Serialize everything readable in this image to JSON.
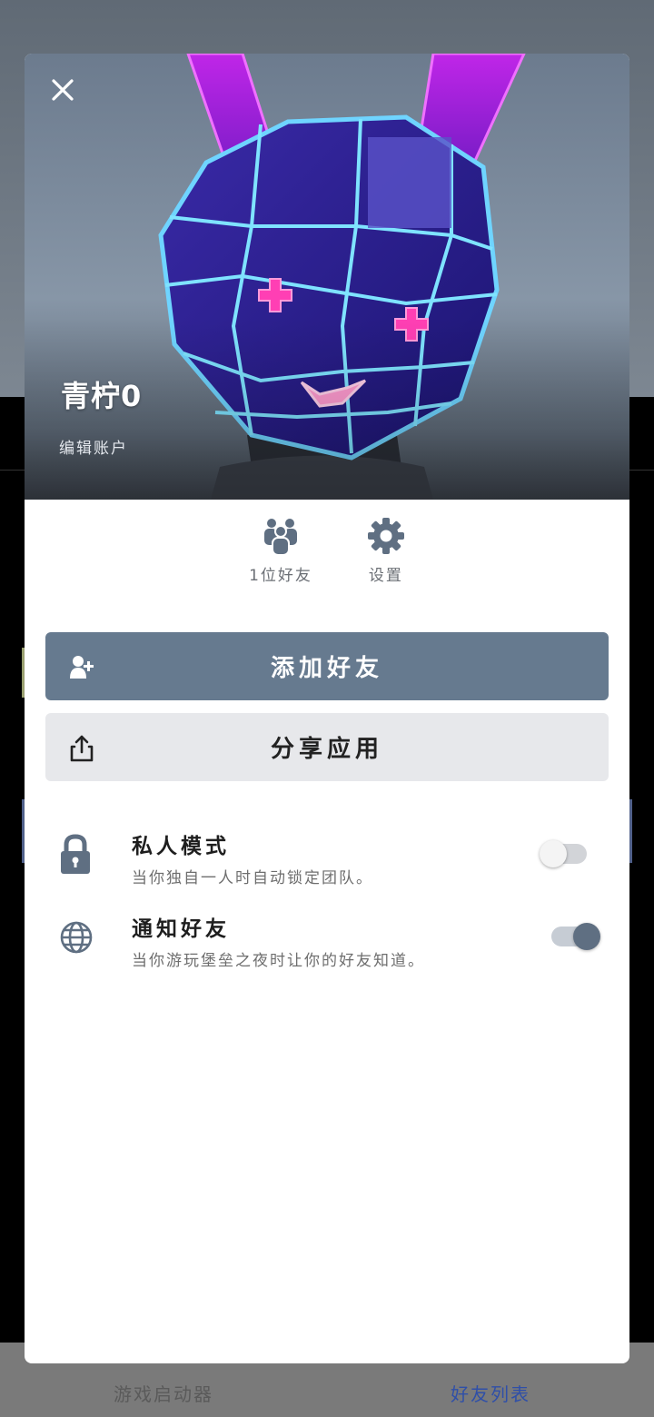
{
  "background": {
    "bottom_nav": {
      "items": [
        {
          "label": "游戏启动器",
          "icon": "play-circle-icon",
          "active": false
        },
        {
          "label": "好友列表",
          "icon": "friends-icon",
          "active": true
        }
      ]
    }
  },
  "modal": {
    "close_icon": "close-icon",
    "hero": {
      "image": "neon-bunny-mask-avatar",
      "username": "青柠0",
      "edit_account": "编辑账户"
    },
    "quick_actions": [
      {
        "label": "1位好友",
        "icon": "friends-icon"
      },
      {
        "label": "设置",
        "icon": "gear-icon"
      }
    ],
    "buttons": {
      "add_friend": {
        "label": "添加好友",
        "icon": "add-person-icon",
        "color": "#667a8f"
      },
      "share_app": {
        "label": "分享应用",
        "icon": "share-icon",
        "color": "#e7e8eb"
      }
    },
    "settings": [
      {
        "title": "私人模式",
        "description": "当你独自一人时自动锁定团队。",
        "icon": "lock-icon",
        "enabled": false
      },
      {
        "title": "通知好友",
        "description": "当你游玩堡垒之夜时让你的好友知道。",
        "icon": "globe-icon",
        "enabled": true
      }
    ]
  }
}
